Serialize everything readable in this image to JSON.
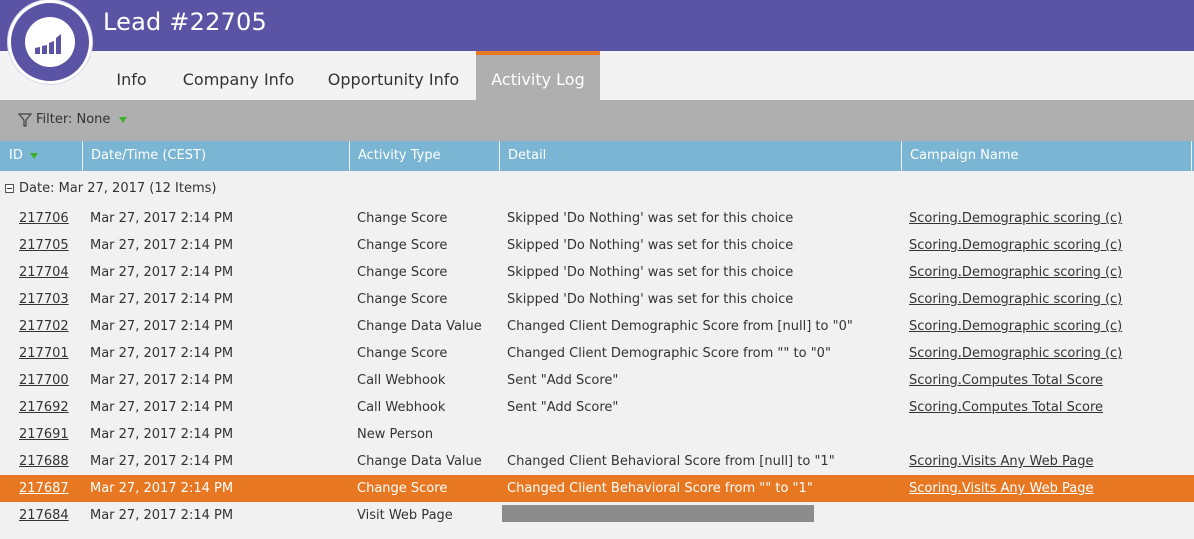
{
  "header": {
    "title": "Lead #22705"
  },
  "tabs": [
    {
      "label": "Info",
      "active": false
    },
    {
      "label": "Company Info",
      "active": false
    },
    {
      "label": "Opportunity Info",
      "active": false
    },
    {
      "label": "Activity Log",
      "active": true
    }
  ],
  "filter": {
    "label": "Filter: None"
  },
  "columns": [
    "ID",
    "Date/Time (CEST)",
    "Activity Type",
    "Detail",
    "Campaign Name"
  ],
  "group": {
    "label": "Date: Mar 27, 2017 (12 Items)"
  },
  "rows": [
    {
      "id": "217706",
      "datetime": "Mar 27, 2017 2:14 PM",
      "type": "Change Score",
      "detail": "Skipped 'Do Nothing' was set for this choice",
      "campaign": "Scoring.Demographic scoring (c)"
    },
    {
      "id": "217705",
      "datetime": "Mar 27, 2017 2:14 PM",
      "type": "Change Score",
      "detail": "Skipped 'Do Nothing' was set for this choice",
      "campaign": "Scoring.Demographic scoring (c)"
    },
    {
      "id": "217704",
      "datetime": "Mar 27, 2017 2:14 PM",
      "type": "Change Score",
      "detail": "Skipped 'Do Nothing' was set for this choice",
      "campaign": "Scoring.Demographic scoring (c)"
    },
    {
      "id": "217703",
      "datetime": "Mar 27, 2017 2:14 PM",
      "type": "Change Score",
      "detail": "Skipped 'Do Nothing' was set for this choice",
      "campaign": "Scoring.Demographic scoring (c)"
    },
    {
      "id": "217702",
      "datetime": "Mar 27, 2017 2:14 PM",
      "type": "Change Data Value",
      "detail": "Changed Client Demographic Score from [null] to \"0\"",
      "campaign": "Scoring.Demographic scoring (c)"
    },
    {
      "id": "217701",
      "datetime": "Mar 27, 2017 2:14 PM",
      "type": "Change Score",
      "detail": "Changed Client Demographic Score from \"\" to \"0\"",
      "campaign": "Scoring.Demographic scoring (c)"
    },
    {
      "id": "217700",
      "datetime": "Mar 27, 2017 2:14 PM",
      "type": "Call Webhook",
      "detail": "Sent \"Add Score\"",
      "campaign": "Scoring.Computes Total Score"
    },
    {
      "id": "217692",
      "datetime": "Mar 27, 2017 2:14 PM",
      "type": "Call Webhook",
      "detail": "Sent \"Add Score\"",
      "campaign": "Scoring.Computes Total Score"
    },
    {
      "id": "217691",
      "datetime": "Mar 27, 2017 2:14 PM",
      "type": "New Person",
      "detail": "",
      "campaign": ""
    },
    {
      "id": "217688",
      "datetime": "Mar 27, 2017 2:14 PM",
      "type": "Change Data Value",
      "detail": "Changed Client Behavioral Score from [null] to \"1\"",
      "campaign": "Scoring.Visits Any Web Page"
    },
    {
      "id": "217687",
      "datetime": "Mar 27, 2017 2:14 PM",
      "type": "Change Score",
      "detail": "Changed Client Behavioral Score from \"\" to \"1\"",
      "campaign": "Scoring.Visits Any Web Page",
      "selected": true
    },
    {
      "id": "217684",
      "datetime": "Mar 27, 2017 2:14 PM",
      "type": "Visit Web Page",
      "detail": "",
      "campaign": "",
      "redacted": true
    }
  ],
  "colors": {
    "header": "#5b53a4",
    "accent": "#e87722",
    "column_header": "#7ab6d3",
    "filter_bar": "#afafaf"
  },
  "icons": {
    "logo": "marketo-bars-logo",
    "filter": "funnel-icon",
    "sort": "sort-desc-icon"
  }
}
